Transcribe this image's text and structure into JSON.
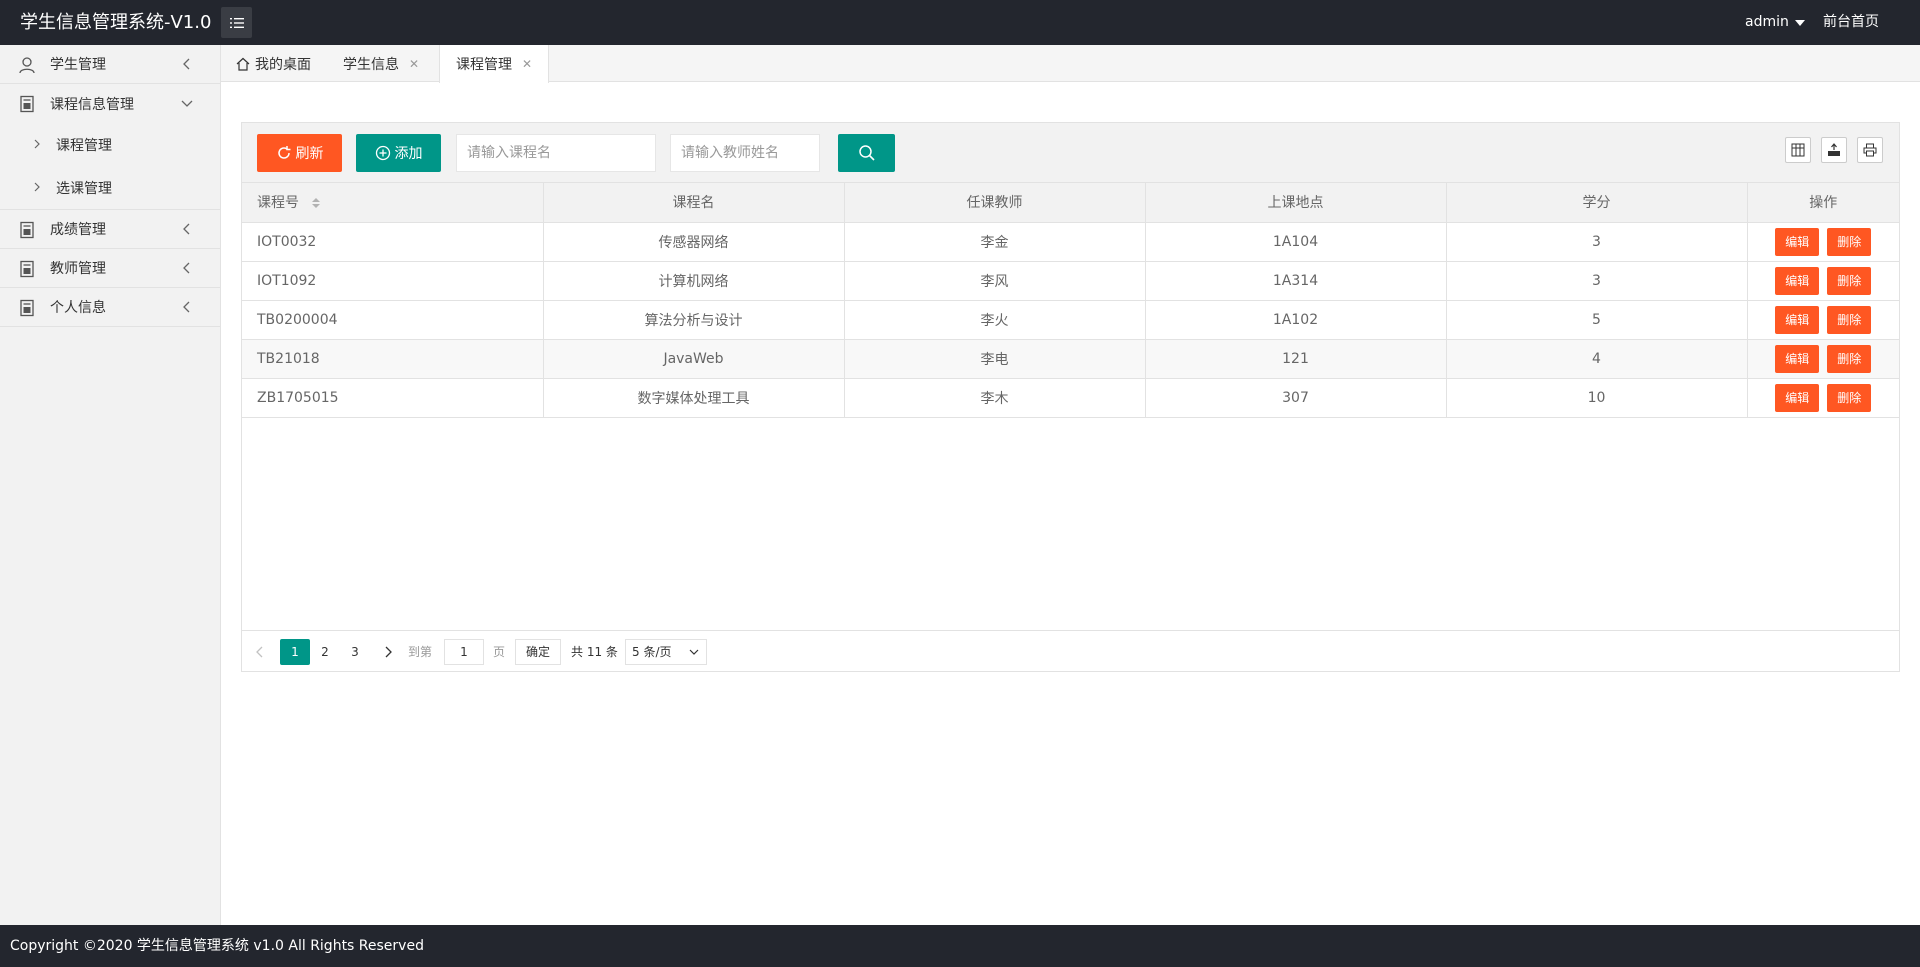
{
  "header": {
    "app_title": "学生信息管理系统-V1.0",
    "user": "admin",
    "front_link": "前台首页"
  },
  "sidebar": {
    "items": [
      {
        "label": "学生管理",
        "icon": "user-icon"
      },
      {
        "label": "课程信息管理",
        "icon": "doc-icon",
        "expanded": true,
        "children": [
          {
            "label": "课程管理"
          },
          {
            "label": "选课管理"
          }
        ]
      },
      {
        "label": "成绩管理",
        "icon": "doc-icon"
      },
      {
        "label": "教师管理",
        "icon": "doc-icon"
      },
      {
        "label": "个人信息",
        "icon": "doc-icon"
      }
    ]
  },
  "tabs": [
    {
      "label": "我的桌面",
      "icon": "home-icon",
      "closable": false
    },
    {
      "label": "学生信息",
      "closable": true
    },
    {
      "label": "课程管理",
      "closable": true,
      "active": true
    }
  ],
  "toolbar": {
    "refresh_label": "刷新",
    "add_label": "添加",
    "course_placeholder": "请输入课程名",
    "teacher_placeholder": "请输入教师姓名"
  },
  "table": {
    "headers": [
      "课程号",
      "课程名",
      "任课教师",
      "上课地点",
      "学分",
      "操作"
    ],
    "edit_label": "编辑",
    "delete_label": "删除",
    "rows": [
      {
        "id": "IOT0032",
        "name": "传感器网络",
        "teacher": "李金",
        "place": "1A104",
        "credit": "3"
      },
      {
        "id": "IOT1092",
        "name": "计算机网络",
        "teacher": "李风",
        "place": "1A314",
        "credit": "3"
      },
      {
        "id": "TB0200004",
        "name": "算法分析与设计",
        "teacher": "李火",
        "place": "1A102",
        "credit": "5"
      },
      {
        "id": "TB21018",
        "name": "JavaWeb",
        "teacher": "李电",
        "place": "121",
        "credit": "4"
      },
      {
        "id": "ZB1705015",
        "name": "数字媒体处理工具",
        "teacher": "李木",
        "place": "307",
        "credit": "10"
      }
    ]
  },
  "pager": {
    "pages": [
      "1",
      "2",
      "3"
    ],
    "current": "1",
    "goto_label": "到第",
    "goto_value": "1",
    "page_unit": "页",
    "ok_label": "确定",
    "total": "共 11 条",
    "per_page": "5 条/页"
  },
  "footer": {
    "copyright": "Copyright ©2020 学生信息管理系统 v1.0 All Rights Reserved"
  },
  "colors": {
    "header_bg": "#23262e",
    "accent_green": "#009688",
    "accent_orange": "#ff5722"
  }
}
